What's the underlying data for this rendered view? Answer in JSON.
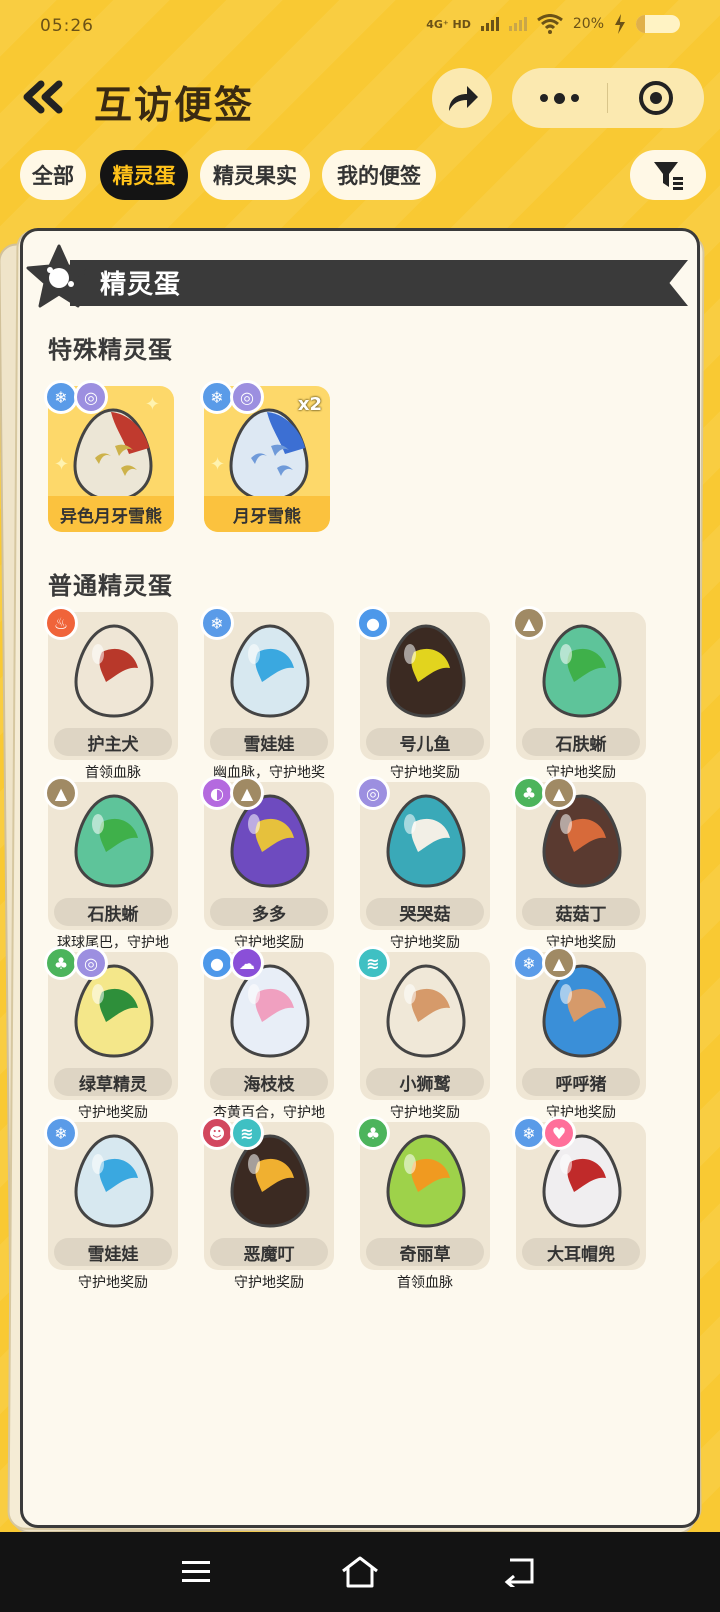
{
  "status_bar": {
    "time": "05:26",
    "network": "4G⁺ HD",
    "battery": "20%"
  },
  "header": {
    "title": "互访便签"
  },
  "tabs": [
    {
      "label": "全部",
      "active": false
    },
    {
      "label": "精灵蛋",
      "active": true
    },
    {
      "label": "精灵果实",
      "active": false
    },
    {
      "label": "我的便签",
      "active": false
    }
  ],
  "card": {
    "banner_title": "精灵蛋",
    "special_section": "特殊精灵蛋",
    "normal_section": "普通精灵蛋",
    "special_eggs": [
      {
        "name": "异色月牙雪熊",
        "badges": [
          "ice",
          "spiral"
        ],
        "multiplier": ""
      },
      {
        "name": "月牙雪熊",
        "badges": [
          "ice",
          "spiral"
        ],
        "multiplier": "x2"
      }
    ],
    "normal_eggs": [
      {
        "name": "护主犬",
        "sub": "首领血脉",
        "badges": [
          "fire"
        ]
      },
      {
        "name": "雪娃娃",
        "sub": "幽血脉，守护地奖",
        "badges": [
          "ice"
        ]
      },
      {
        "name": "号儿鱼",
        "sub": "守护地奖励",
        "badges": [
          "water"
        ]
      },
      {
        "name": "石肤蜥",
        "sub": "守护地奖励",
        "badges": [
          "rock"
        ]
      },
      {
        "name": "石肤蜥",
        "sub": "球球尾巴，守护地",
        "badges": [
          "rock"
        ]
      },
      {
        "name": "多多",
        "sub": "守护地奖励",
        "badges": [
          "psychic",
          "rock"
        ]
      },
      {
        "name": "哭哭菇",
        "sub": "守护地奖励",
        "badges": [
          "spiral"
        ]
      },
      {
        "name": "菇菇丁",
        "sub": "守护地奖励",
        "badges": [
          "grass",
          "rock"
        ]
      },
      {
        "name": "绿草精灵",
        "sub": "守护地奖励",
        "badges": [
          "grass",
          "spiral"
        ]
      },
      {
        "name": "海枝枝",
        "sub": "杏黄百合，守护地",
        "badges": [
          "water",
          "ghost"
        ]
      },
      {
        "name": "小狮鹫",
        "sub": "守护地奖励",
        "badges": [
          "wing"
        ]
      },
      {
        "name": "呼呼猪",
        "sub": "守护地奖励",
        "badges": [
          "ice",
          "rock"
        ]
      },
      {
        "name": "雪娃娃",
        "sub": "守护地奖励",
        "badges": [
          "ice"
        ]
      },
      {
        "name": "恶魔叮",
        "sub": "守护地奖励",
        "badges": [
          "demon",
          "wing"
        ]
      },
      {
        "name": "奇丽草",
        "sub": "首领血脉",
        "badges": [
          "grass"
        ]
      },
      {
        "name": "大耳帽兜",
        "sub": "",
        "badges": [
          "ice",
          "heart"
        ]
      }
    ]
  },
  "colors": {
    "background": "#f9c933",
    "active_tab_bg": "#141414",
    "active_tab_text": "#ffc21a",
    "card_bg": "#fdf9ee",
    "special_tile": "#fdd86a"
  }
}
